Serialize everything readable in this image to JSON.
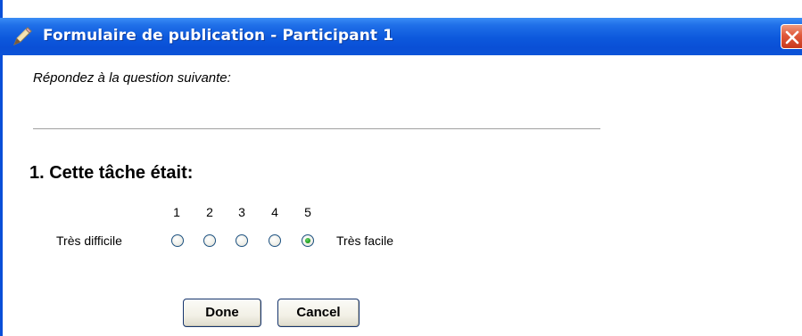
{
  "window": {
    "title": "Formulaire de publication - Participant 1",
    "title_icon": "pencil-icon",
    "close_icon": "close-icon",
    "colors": {
      "titlebar": "#0c58dc",
      "close_button": "#d9482c"
    }
  },
  "form": {
    "prompt": "Répondez à la question suivante:",
    "question": "1. Cette tâche était:",
    "scale": {
      "numbers": [
        "1",
        "2",
        "3",
        "4",
        "5"
      ],
      "min_label": "Très difficile",
      "max_label": "Très facile",
      "selected": "5"
    }
  },
  "buttons": {
    "done": "Done",
    "cancel": "Cancel"
  }
}
